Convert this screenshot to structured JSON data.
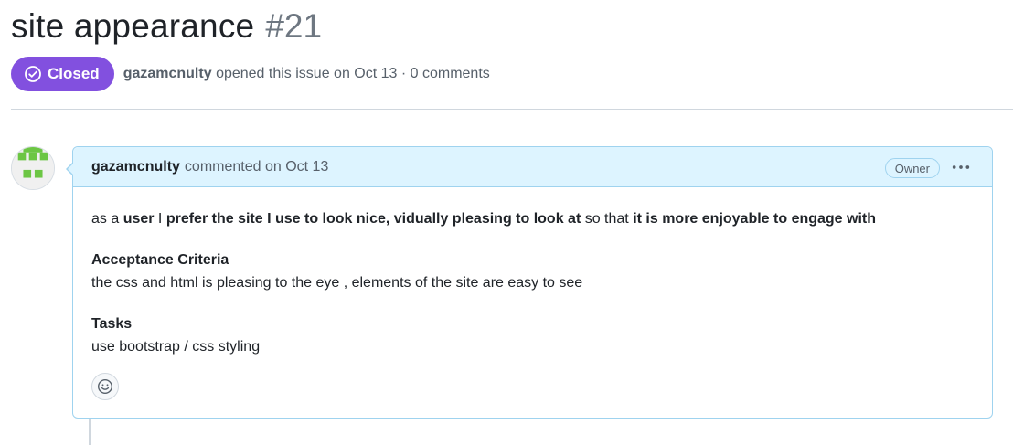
{
  "issue": {
    "title": "site appearance",
    "number": "#21",
    "state": "Closed",
    "author": "gazamcnulty",
    "opened_text": "opened this issue on Oct 13 · 0 comments"
  },
  "comment": {
    "author": "gazamcnulty",
    "action_text": "commented on Oct 13",
    "role_badge": "Owner",
    "body": {
      "story": {
        "t1": "as a ",
        "b1": "user",
        "t2": " I ",
        "b2": "prefer the site I use to look nice, vidually pleasing to look at",
        "t3": " so that ",
        "b3": "it is more enjoyable to engage with"
      },
      "acceptance_heading": "Acceptance Criteria",
      "acceptance_text": "the css and html is pleasing to the eye , elements of the site are easy to see",
      "tasks_heading": "Tasks",
      "tasks_text": "use bootstrap / css styling"
    }
  },
  "icons": {
    "state": "check-circle-icon",
    "menu": "kebab-horizontal-icon",
    "reaction": "smiley-icon"
  },
  "colors": {
    "closed_badge": "#8250df",
    "comment_header_bg": "#ddf4ff",
    "comment_border": "#9fd3ef",
    "avatar_green": "#6cc644"
  }
}
